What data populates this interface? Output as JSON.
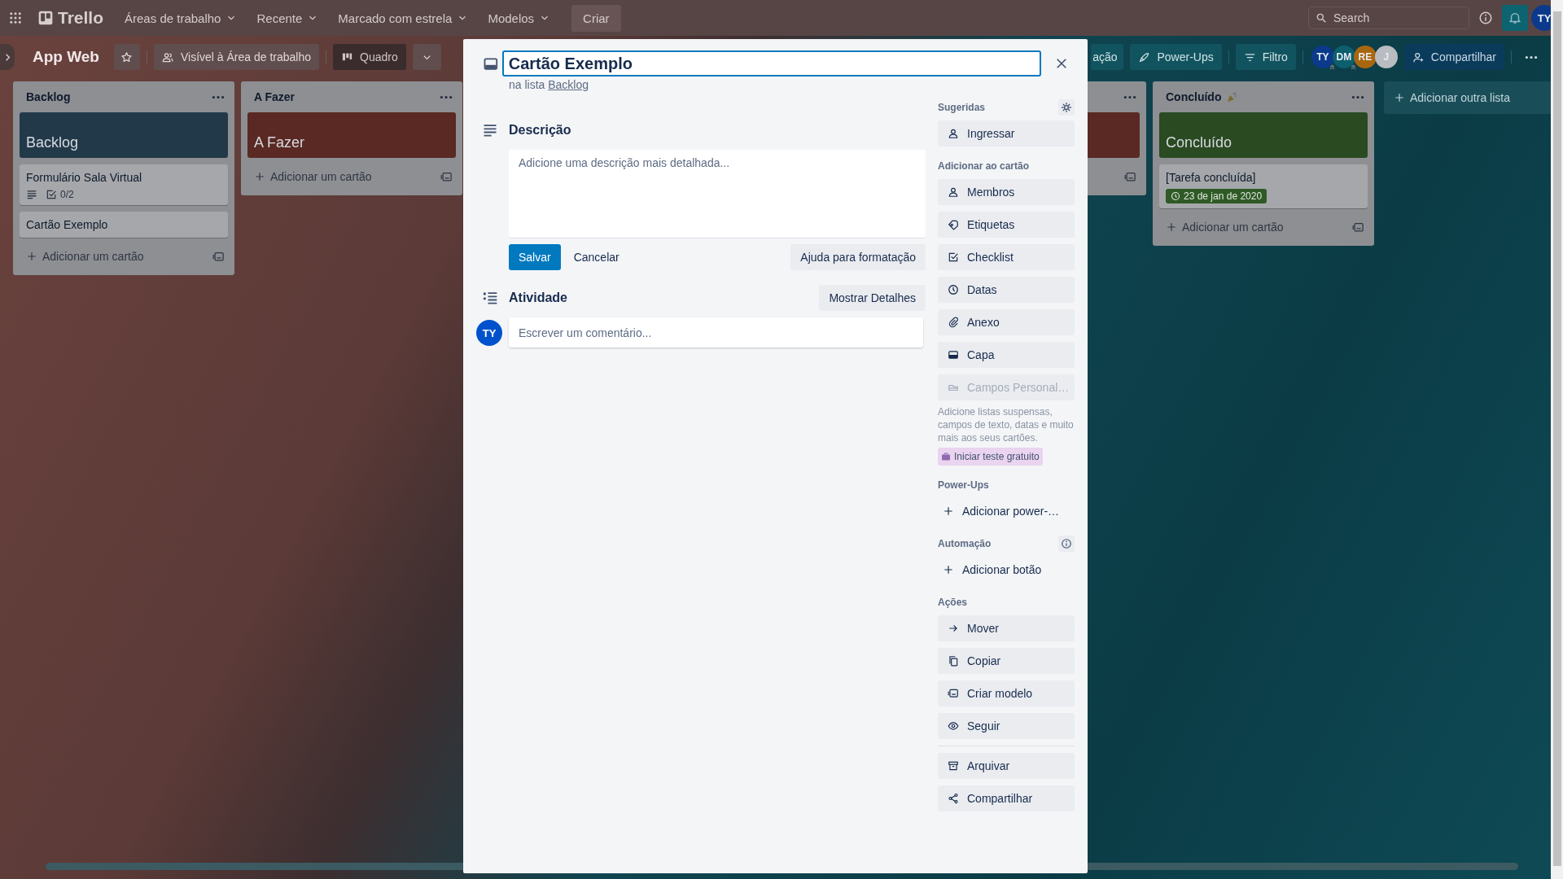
{
  "top_bar": {
    "logo": "Trello",
    "menus": [
      {
        "label": "Áreas de trabalho"
      },
      {
        "label": "Recente"
      },
      {
        "label": "Marcado com estrela"
      },
      {
        "label": "Modelos"
      }
    ],
    "create_button": "Criar",
    "search": {
      "placeholder": "Search"
    },
    "avatar": "TY"
  },
  "board_header": {
    "title": "App Web",
    "starred": false,
    "visibility": "Visível à Área de trabalho",
    "view": "Quadro",
    "automation": "ação",
    "power_ups": "Power-Ups",
    "filter": "Filtro",
    "members": [
      {
        "initials": "TY",
        "color": "#0b3a8c",
        "admin": true
      },
      {
        "initials": "DM",
        "color": "#0d5f6e",
        "admin": true
      },
      {
        "initials": "RE",
        "color": "#a8670f",
        "admin": false
      },
      {
        "initials": "J",
        "color": "#b9bcc0",
        "admin": false
      }
    ],
    "share": "Compartilhar"
  },
  "lists": [
    {
      "title": "Backlog",
      "has_emoji": false,
      "cover": {
        "text": "Backlog",
        "color": "#22394a"
      },
      "cards": [
        {
          "title": "Formulário Sala Virtual",
          "has_description": true,
          "checklist": "0/2"
        },
        {
          "title": "Cartão Exemplo",
          "has_description": false
        }
      ],
      "add_card": "Adicionar um cartão"
    },
    {
      "title": "A Fazer",
      "has_emoji": false,
      "cover": {
        "text": "A Fazer",
        "color": "#5a2924"
      },
      "add_card": "Adicionar um cartão"
    },
    {
      "cover": {
        "color": "#5a2924"
      }
    },
    {
      "title": "Concluído",
      "has_emoji": true,
      "cover": {
        "text": "Concluído",
        "color": "#2a4a22"
      },
      "cards": [
        {
          "title": "[Tarefa concluída]",
          "has_description": false,
          "due": {
            "text": "23 de jan de 2020",
            "complete": true
          }
        }
      ],
      "add_card": "Adicionar um cartão"
    }
  ],
  "add_list": "Adicionar outra lista",
  "card_modal": {
    "title": "Cartão Exemplo",
    "list_prefix": "na lista",
    "list_name": "Backlog",
    "description": {
      "heading": "Descrição",
      "placeholder": "Adicione uma descrição mais detalhada...",
      "save": "Salvar",
      "cancel": "Cancelar",
      "help": "Ajuda para formatação"
    },
    "activity": {
      "heading": "Atividade",
      "details_button": "Mostrar Detalhes",
      "avatar": "TY",
      "comment_placeholder": "Escrever um comentário..."
    },
    "sidebar": [
      {
        "title": "Sugeridas",
        "settings": true,
        "items": [
          {
            "label": "Ingressar",
            "kind": "button",
            "disabled": false
          }
        ]
      },
      {
        "title": "Adicionar ao cartão",
        "items": [
          {
            "label": "Membros",
            "kind": "button",
            "disabled": false
          },
          {
            "label": "Etiquetas",
            "kind": "button",
            "disabled": false
          },
          {
            "label": "Checklist",
            "kind": "button",
            "disabled": false
          },
          {
            "label": "Datas",
            "kind": "button",
            "disabled": false
          },
          {
            "label": "Anexo",
            "kind": "button",
            "disabled": false
          },
          {
            "label": "Capa",
            "kind": "button",
            "disabled": false
          },
          {
            "label": "Campos Personal…",
            "kind": "button",
            "disabled": true
          }
        ],
        "note": "Adicione listas suspensas, campos de texto, datas e muito mais aos seus cartões.",
        "trial_button": "Iniciar teste gratuito"
      },
      {
        "title": "Power-Ups",
        "items": [
          {
            "label": "Adicionar power-…",
            "kind": "add",
            "disabled": false
          }
        ]
      },
      {
        "title": "Automação",
        "info": true,
        "items": [
          {
            "label": "Adicionar botão",
            "kind": "add",
            "disabled": false
          }
        ]
      },
      {
        "title": "Ações",
        "items": [
          {
            "label": "Mover",
            "kind": "button",
            "disabled": false
          },
          {
            "label": "Copiar",
            "kind": "button",
            "disabled": false
          },
          {
            "label": "Criar modelo",
            "kind": "button",
            "disabled": false
          },
          {
            "label": "Seguir",
            "kind": "button",
            "disabled": false
          }
        ],
        "more_items": [
          {
            "label": "Arquivar",
            "kind": "button",
            "disabled": false
          },
          {
            "label": "Compartilhar",
            "kind": "button",
            "disabled": false
          }
        ]
      }
    ]
  }
}
